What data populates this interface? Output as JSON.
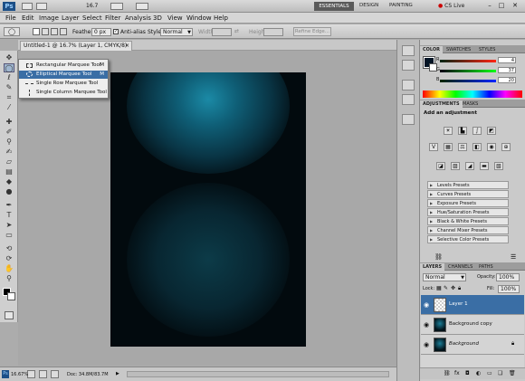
{
  "title_bar": {
    "app_logo": "Ps",
    "zoom": "16.7",
    "workspaces": [
      "ESSENTIALS",
      "DESIGN",
      "PAINTING"
    ],
    "cs_live": "CS Live"
  },
  "menus": [
    "File",
    "Edit",
    "Image",
    "Layer",
    "Select",
    "Filter",
    "Analysis",
    "3D",
    "View",
    "Window",
    "Help"
  ],
  "options_bar": {
    "feather_label": "Feather:",
    "feather_value": "0 px",
    "antialias_label": "Anti-alias",
    "style_label": "Style:",
    "style_value": "Normal",
    "width_label": "Width:",
    "height_label": "Height:",
    "refine_edge": "Refine Edge..."
  },
  "document_tab": {
    "label": "Untitled-1 @ 16.7% (Layer 1, CMYK/8) *"
  },
  "marquee_flyout": {
    "items": [
      {
        "label": "Rectangular Marquee Tool",
        "shortcut": "M"
      },
      {
        "label": "Elliptical Marquee Tool",
        "shortcut": "M"
      },
      {
        "label": "Single Row Marquee Tool",
        "shortcut": ""
      },
      {
        "label": "Single Column Marquee Tool",
        "shortcut": ""
      }
    ]
  },
  "status_bar": {
    "zoom": "16.67%",
    "doc_info": "Doc: 34.8M/83.7M"
  },
  "color_panel": {
    "tabs": [
      "COLOR",
      "SWATCHES",
      "STYLES"
    ],
    "channels": [
      {
        "label": "R",
        "value": "4"
      },
      {
        "label": "G",
        "value": "37"
      },
      {
        "label": "B",
        "value": "20"
      }
    ]
  },
  "adjustments_panel": {
    "tabs": [
      "ADJUSTMENTS",
      "MASKS"
    ],
    "heading": "Add an adjustment",
    "presets": [
      "Levels Presets",
      "Curves Presets",
      "Exposure Presets",
      "Hue/Saturation Presets",
      "Black & White Presets",
      "Channel Mixer Presets",
      "Selective Color Presets"
    ]
  },
  "layers_panel": {
    "tabs": [
      "LAYERS",
      "CHANNELS",
      "PATHS"
    ],
    "blend_mode": "Normal",
    "opacity_label": "Opacity:",
    "opacity_value": "100%",
    "lock_label": "Lock:",
    "fill_label": "Fill:",
    "fill_value": "100%",
    "layers": [
      "Layer 1",
      "Background copy",
      "Background"
    ]
  },
  "colors": {
    "canvas_dark": "#020a0e",
    "glow_teal": "#1b8aa6",
    "selection_blue": "#3a6ea5"
  }
}
